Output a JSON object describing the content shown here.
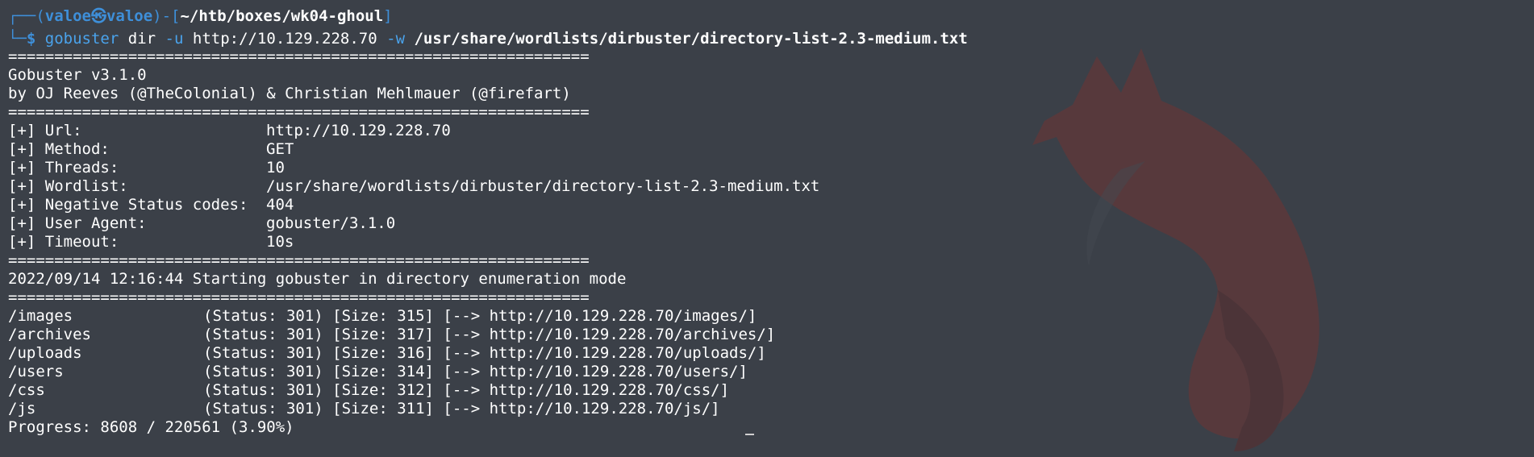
{
  "prompt": {
    "frame_open": "┌──(",
    "user": "valoe㉿valoe",
    "frame_mid": ")-[",
    "path": "~/htb/boxes/wk04-ghoul",
    "frame_close": "]",
    "line2_prefix": "└─",
    "dollar": "$",
    "command": {
      "bin": "gobuster",
      "sub": "dir",
      "flag_u": "-u",
      "url": "http://10.129.228.70",
      "flag_w": "-w",
      "wordlist": "/usr/share/wordlists/dirbuster/directory-list-2.3-medium.txt"
    }
  },
  "separator": "===============================================================",
  "banner": {
    "version": "Gobuster v3.1.0",
    "authors": "by OJ Reeves (@TheColonial) & Christian Mehlmauer (@firefart)"
  },
  "config": [
    {
      "key": "[+] Url:",
      "value": "http://10.129.228.70"
    },
    {
      "key": "[+] Method:",
      "value": "GET"
    },
    {
      "key": "[+] Threads:",
      "value": "10"
    },
    {
      "key": "[+] Wordlist:",
      "value": "/usr/share/wordlists/dirbuster/directory-list-2.3-medium.txt"
    },
    {
      "key": "[+] Negative Status codes:",
      "value": "404"
    },
    {
      "key": "[+] User Agent:",
      "value": "gobuster/3.1.0"
    },
    {
      "key": "[+] Timeout:",
      "value": "10s"
    }
  ],
  "start_message": "2022/09/14 12:16:44 Starting gobuster in directory enumeration mode",
  "results": [
    {
      "path": "/images",
      "info": "(Status: 301) [Size: 315] [--> http://10.129.228.70/images/]"
    },
    {
      "path": "/archives",
      "info": "(Status: 301) [Size: 317] [--> http://10.129.228.70/archives/]"
    },
    {
      "path": "/uploads",
      "info": "(Status: 301) [Size: 316] [--> http://10.129.228.70/uploads/]"
    },
    {
      "path": "/users",
      "info": "(Status: 301) [Size: 314] [--> http://10.129.228.70/users/]"
    },
    {
      "path": "/css",
      "info": "(Status: 301) [Size: 312] [--> http://10.129.228.70/css/]"
    },
    {
      "path": "/js",
      "info": "(Status: 301) [Size: 311] [--> http://10.129.228.70/js/]"
    }
  ],
  "progress": "Progress: 8608 / 220561 (3.90%)",
  "colors": {
    "background": "#3b4048",
    "prompt_blue": "#3e8fd9",
    "text": "#ffffff",
    "fox_art": "#6e3434"
  },
  "icons": {
    "background_art": "fox-silhouette-icon"
  }
}
